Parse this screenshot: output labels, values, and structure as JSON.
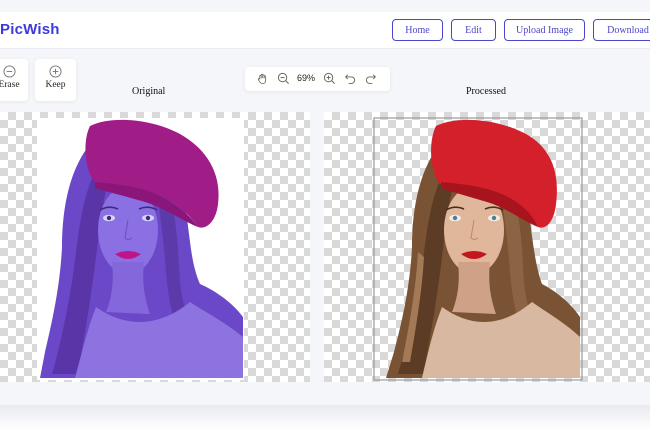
{
  "app": {
    "logo": "PicWish"
  },
  "nav": {
    "home": "Home",
    "edit": "Edit",
    "upload": "Upload Image",
    "download": "Download"
  },
  "tools": {
    "erase": "Erase",
    "keep": "Keep"
  },
  "zoom": {
    "level": "69%"
  },
  "panels": {
    "original": "Original",
    "processed": "Processed"
  },
  "colors": {
    "brand": "#3c3ae0",
    "button_border": "#4b47c9",
    "original_overlay": "#6a4fd8",
    "hat_red": "#d4202a"
  },
  "icons": {
    "erase": "minus-circle-icon",
    "keep": "plus-circle-icon",
    "pan": "hand-icon",
    "zoom_out": "zoom-out-icon",
    "zoom_in": "zoom-in-icon",
    "undo": "undo-icon",
    "redo": "redo-icon"
  }
}
